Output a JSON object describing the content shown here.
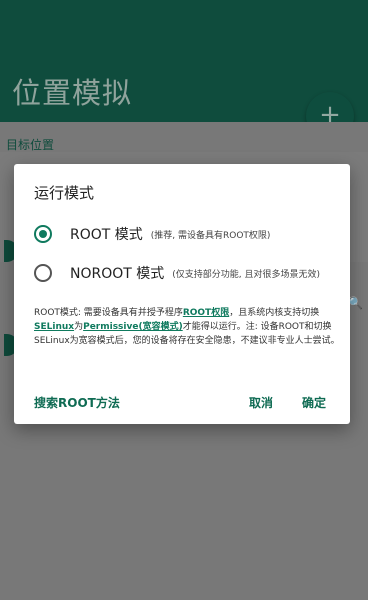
{
  "app": {
    "title": "位置模拟",
    "fab_symbol": "+",
    "section_label": "目标位置"
  },
  "dialog": {
    "title": "运行模式",
    "options": [
      {
        "label": "ROOT 模式",
        "hint": "(推荐, 需设备具有ROOT权限)",
        "selected": true
      },
      {
        "label": "NOROOT 模式",
        "hint": "(仅支持部分功能, 且对很多场景无效)",
        "selected": false
      }
    ],
    "description": {
      "p1": "ROOT模式: 需要设备具有并授予程序",
      "link1": "ROOT权限",
      "p2": "，且系统内核支持切换",
      "link2": "SELinux",
      "p3": "为",
      "link3": "Permissive(宽容模式)",
      "p4": "才能得以运行。注: 设备ROOT和切换SELinux为宽容模式后，您的设备将存在安全隐患，不建议非专业人士尝试。"
    },
    "actions": {
      "help": "搜索ROOT方法",
      "cancel": "取消",
      "confirm": "确定"
    }
  },
  "colors": {
    "accent": "#0f7a5e",
    "header_dimmed": "#0f4c3d",
    "scrim": "#767676"
  }
}
